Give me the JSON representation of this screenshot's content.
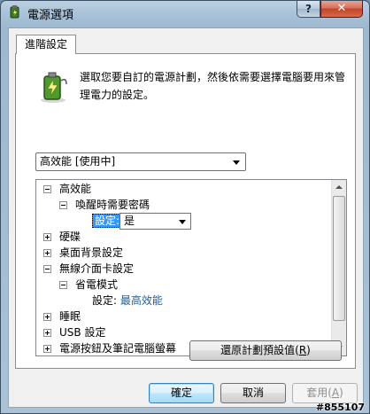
{
  "window": {
    "title": "電源選項",
    "help_label": "?",
    "close_label": "✕"
  },
  "tab": {
    "label": "進階設定"
  },
  "description": "選取您要自訂的電源計劃，然後依需要選擇電腦要用來管理電力的設定。",
  "plan_dropdown": {
    "value": "高效能 [使用中]"
  },
  "tree": {
    "items": [
      {
        "text": "高效能",
        "expander": "minus",
        "level": 0
      },
      {
        "text": "喚醒時需要密碼",
        "expander": "minus",
        "level": 1
      },
      {
        "text": "硬碟",
        "expander": "plus",
        "level": 0
      },
      {
        "text": "桌面背景設定",
        "expander": "plus",
        "level": 0
      },
      {
        "text": "無線介面卡設定",
        "expander": "minus",
        "level": 0
      },
      {
        "text": "省電模式",
        "expander": "minus",
        "level": 1
      },
      {
        "text": "睡眠",
        "expander": "plus",
        "level": 0
      },
      {
        "text": "USB 設定",
        "expander": "plus",
        "level": 0
      },
      {
        "text": "電源按鈕及筆記電腦螢幕",
        "expander": "plus",
        "level": 0
      }
    ],
    "password_setting": {
      "label": "設定:",
      "value": "是"
    },
    "power_saving_setting": {
      "label": "設定:",
      "value": "最高效能"
    }
  },
  "restore_button": {
    "label": "還原計劃預設值(",
    "accel": "R",
    "suffix": ")"
  },
  "buttons": {
    "ok": "確定",
    "cancel": "取消",
    "apply_label": "套用(",
    "apply_accel": "A",
    "apply_suffix": ")"
  },
  "watermark": "#855107"
}
